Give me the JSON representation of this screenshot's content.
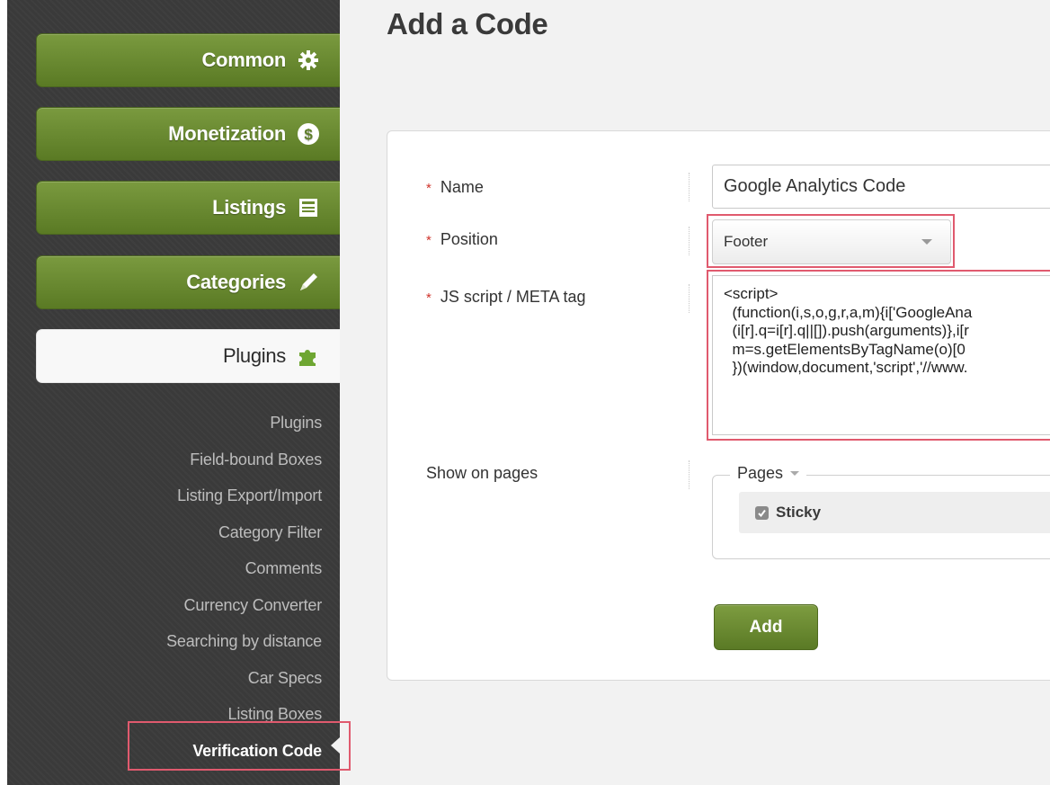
{
  "sidebar": {
    "nav": [
      {
        "label": "Common",
        "icon": "gear-icon"
      },
      {
        "label": "Monetization",
        "icon": "dollar-coin-icon"
      },
      {
        "label": "Listings",
        "icon": "listing-icon"
      },
      {
        "label": "Categories",
        "icon": "pencil-icon"
      },
      {
        "label": "Plugins",
        "icon": "puzzle-icon"
      }
    ],
    "sub_items": [
      "Plugins",
      "Field-bound Boxes",
      "Listing Export/Import",
      "Category Filter",
      "Comments",
      "Currency Converter",
      "Searching by distance",
      "Car Specs",
      "Listing Boxes",
      "Verification Code"
    ]
  },
  "main": {
    "title": "Add a Code",
    "form": {
      "required_mark": "*",
      "name_label": "Name",
      "name_value": "Google Analytics Code",
      "position_label": "Position",
      "position_value": "Footer",
      "script_label": "JS script / META tag",
      "script_lines": [
        "<script>",
        "  (function(i,s,o,g,r,a,m){i['GoogleAna",
        "  (i[r].q=i[r].q||[]).push(arguments)},i[r",
        "  m=s.getElementsByTagName(o)[0",
        "  })(window,document,'script','//www."
      ],
      "show_label": "Show on pages",
      "pages_legend": "Pages",
      "sticky_label": "Sticky",
      "add_label": "Add"
    }
  },
  "colors": {
    "nav_green": "#6b8b31",
    "sidebar_dark": "#3a3a3a",
    "highlight": "#e05a6e",
    "required_red": "#d0342c"
  }
}
